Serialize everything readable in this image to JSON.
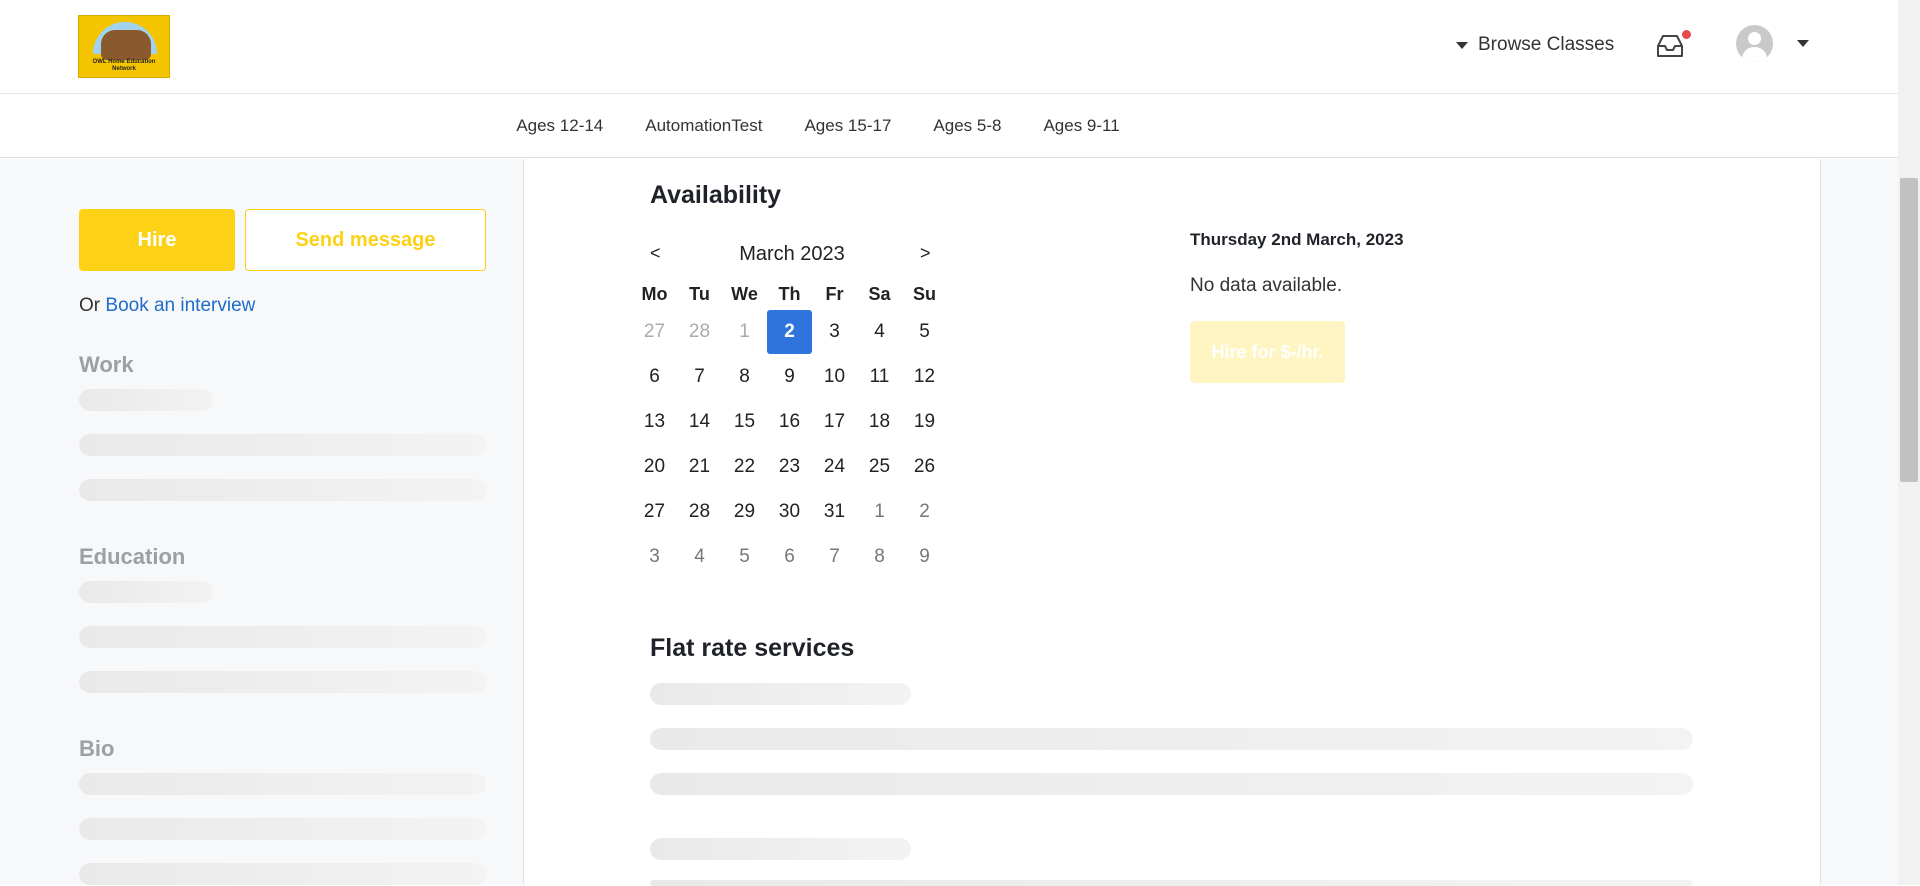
{
  "logo": {
    "text": "OWL Home Education Network"
  },
  "header": {
    "browse_label": "Browse Classes"
  },
  "subnav": [
    "Ages 12-14",
    "AutomationTest",
    "Ages 15-17",
    "Ages 5-8",
    "Ages 9-11"
  ],
  "sidebar": {
    "hire_label": "Hire",
    "message_label": "Send message",
    "or_prefix": "Or",
    "interview_link": "Book an interview",
    "work_heading": "Work",
    "education_heading": "Education",
    "bio_heading": "Bio"
  },
  "availability": {
    "heading": "Availability",
    "prev": "<",
    "next": ">",
    "month_title": "March 2023",
    "weekdays": [
      "Mo",
      "Tu",
      "We",
      "Th",
      "Fr",
      "Sa",
      "Su"
    ],
    "weeks": [
      [
        "27",
        "28",
        "1",
        "2",
        "3",
        "4",
        "5"
      ],
      [
        "6",
        "7",
        "8",
        "9",
        "10",
        "11",
        "12"
      ],
      [
        "13",
        "14",
        "15",
        "16",
        "17",
        "18",
        "19"
      ],
      [
        "20",
        "21",
        "22",
        "23",
        "24",
        "25",
        "26"
      ],
      [
        "27",
        "28",
        "29",
        "30",
        "31",
        "1",
        "2"
      ],
      [
        "3",
        "4",
        "5",
        "6",
        "7",
        "8",
        "9"
      ]
    ],
    "selected_label": "Thursday 2nd March, 2023",
    "no_data": "No data available.",
    "hire_rate_label": "Hire for $-/hr."
  },
  "services": {
    "heading": "Flat rate services"
  },
  "colors": {
    "accent": "#fcd116",
    "link": "#1f6cc9",
    "selected_day": "#2f73dc"
  }
}
